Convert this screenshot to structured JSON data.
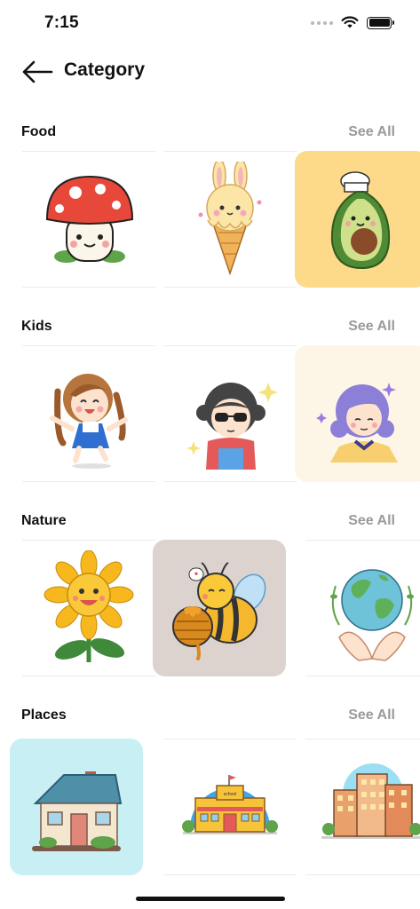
{
  "status_bar": {
    "time": "7:15",
    "icons": [
      "cellular-dots-icon",
      "wifi-icon",
      "battery-icon"
    ]
  },
  "header": {
    "back_icon": "arrow-left-icon",
    "title": "Category"
  },
  "sections": [
    {
      "title": "Food",
      "see_all": "See All",
      "items": [
        {
          "icon": "mushroom-illustration",
          "bg": "#ffffff"
        },
        {
          "icon": "bunny-ice-cream-illustration",
          "bg": "#ffffff"
        },
        {
          "icon": "avocado-chef-illustration",
          "bg": "#fdd98a"
        }
      ]
    },
    {
      "title": "Kids",
      "see_all": "See All",
      "items": [
        {
          "icon": "jumping-girl-illustration",
          "bg": "#ffffff"
        },
        {
          "icon": "kid-sunglasses-illustration",
          "bg": "#ffffff"
        },
        {
          "icon": "purple-hair-girl-illustration",
          "bg": "#fdf5e6"
        }
      ]
    },
    {
      "title": "Nature",
      "see_all": "See All",
      "items": [
        {
          "icon": "sunflower-illustration",
          "bg": "#ffffff"
        },
        {
          "icon": "bee-honey-illustration",
          "bg": "#dcd3ce"
        },
        {
          "icon": "earth-hands-illustration",
          "bg": "#ffffff"
        }
      ]
    },
    {
      "title": "Places",
      "see_all": "See All",
      "items": [
        {
          "icon": "cottage-house-illustration",
          "bg": "#c8f0f4"
        },
        {
          "icon": "school-building-illustration",
          "bg": "#ffffff"
        },
        {
          "icon": "city-apartments-illustration",
          "bg": "#ffffff"
        }
      ]
    }
  ],
  "school_sign": "school",
  "colors": {
    "accent_see_all": "#9a9a9a",
    "title": "#111111"
  }
}
